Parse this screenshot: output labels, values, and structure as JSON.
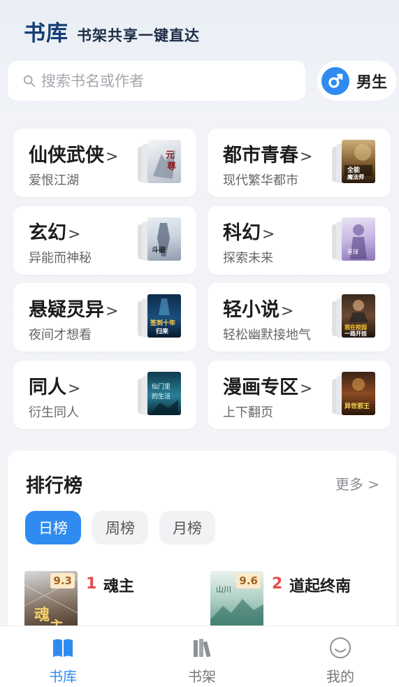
{
  "header": {
    "brand": "书库",
    "slogan": "书架共享一键直达"
  },
  "search": {
    "placeholder": "搜索书名或作者"
  },
  "gender": {
    "label": "男生",
    "icon": "male-icon",
    "accent": "#2f8bf0"
  },
  "categories": [
    {
      "title": "仙侠武侠",
      "subtitle": "爱恨江湖",
      "cover_text": "元尊"
    },
    {
      "title": "都市青春",
      "subtitle": "现代繁华都市",
      "cover_text": "全能魔法师"
    },
    {
      "title": "玄幻",
      "subtitle": "异能而神秘",
      "cover_text": "斗破苍穹"
    },
    {
      "title": "科幻",
      "subtitle": "探索未来",
      "cover_text": "神秘星球"
    },
    {
      "title": "悬疑灵异",
      "subtitle": "夜间才想看",
      "cover_text": "签到十年归来"
    },
    {
      "title": "轻小说",
      "subtitle": "轻松幽默接地气",
      "cover_text": "我在校园一路开挂"
    },
    {
      "title": "同人",
      "subtitle": "衍生同人",
      "cover_text": "仙门里的生活"
    },
    {
      "title": "漫画专区",
      "subtitle": "上下翻页",
      "cover_text": "异世邪王"
    }
  ],
  "ranking": {
    "title": "排行榜",
    "more": "更多",
    "tabs": [
      {
        "label": "日榜",
        "active": true
      },
      {
        "label": "周榜",
        "active": false
      },
      {
        "label": "月榜",
        "active": false
      }
    ],
    "items": [
      {
        "rank": "1",
        "name": "魂主",
        "score": "9.3"
      },
      {
        "rank": "2",
        "name": "道起终南",
        "score": "9.6"
      }
    ]
  },
  "nav": [
    {
      "label": "书库",
      "icon": "book-open-icon",
      "active": true
    },
    {
      "label": "书架",
      "icon": "bookshelf-icon",
      "active": false
    },
    {
      "label": "我的",
      "icon": "smile-icon",
      "active": false
    }
  ]
}
